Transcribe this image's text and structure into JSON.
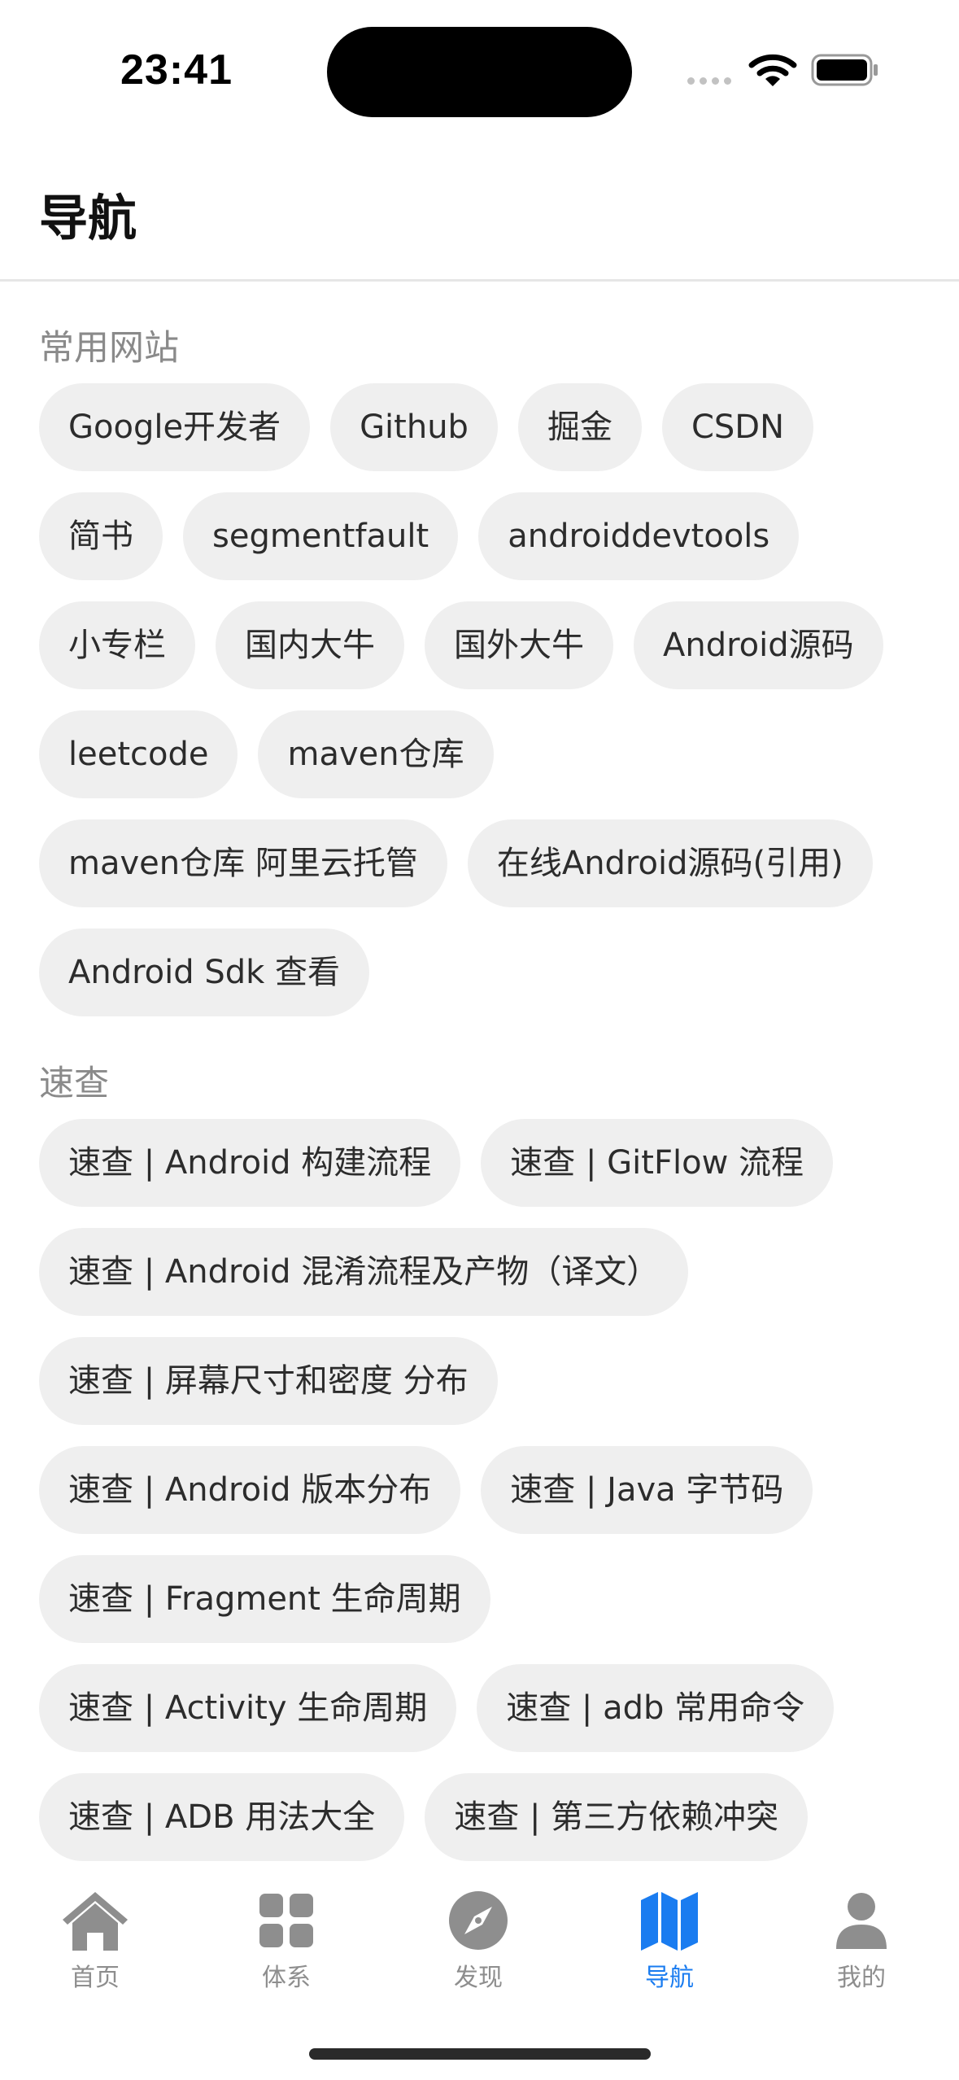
{
  "status": {
    "time": "23:41"
  },
  "header": {
    "title": "导航"
  },
  "sections": [
    {
      "title": "常用网站",
      "items": [
        "Google开发者",
        "Github",
        "掘金",
        "CSDN",
        "简书",
        "segmentfault",
        "androiddevtools",
        "小专栏",
        "国内大牛",
        "国外大牛",
        "Android源码",
        "leetcode",
        "maven仓库",
        "maven仓库 阿里云托管",
        "在线Android源码(引用)",
        "Android Sdk 查看"
      ]
    },
    {
      "title": "速查",
      "items": [
        "速查 | Android 构建流程",
        "速查 | GitFlow 流程",
        "速查 | Android 混淆流程及产物（译文）",
        "速查 | 屏幕尺寸和密度 分布",
        "速查 | Android 版本分布",
        "速查 | Java 字节码",
        "速查 | Fragment 生命周期",
        "速查 | Activity 生命周期",
        "速查 | adb 常用命令",
        "速查 | ADB 用法大全",
        "速查 | 第三方依赖冲突"
      ]
    }
  ],
  "tabs": [
    {
      "label": "首页",
      "icon": "home-icon",
      "active": false
    },
    {
      "label": "体系",
      "icon": "grid-icon",
      "active": false
    },
    {
      "label": "发现",
      "icon": "compass-icon",
      "active": false
    },
    {
      "label": "导航",
      "icon": "map-icon",
      "active": true
    },
    {
      "label": "我的",
      "icon": "person-icon",
      "active": false
    }
  ],
  "colors": {
    "accent": "#1a7cf0",
    "chip_bg": "#efefef",
    "inactive_icon": "#8e8e8e"
  }
}
